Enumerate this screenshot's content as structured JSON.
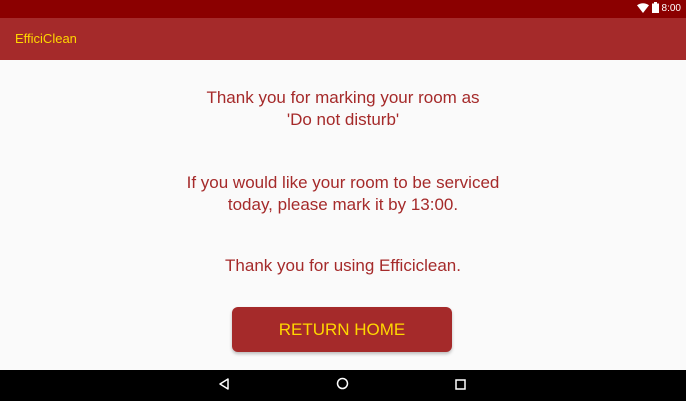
{
  "status_bar": {
    "time": "8:00",
    "icons": [
      "wifi-icon",
      "battery-icon"
    ],
    "background": "#8b0000"
  },
  "app_bar": {
    "title": "EfficiClean",
    "background": "#a52a2a",
    "title_color": "#ffd700"
  },
  "content": {
    "messages": [
      "Thank you for marking your room as\n'Do not disturb'",
      "If you would like your room to be serviced\ntoday, please mark it by 13:00.",
      "Thank you for using Efficiclean."
    ],
    "text_color": "#a52a2a",
    "return_button": {
      "label": "RETURN HOME",
      "background": "#a52a2a",
      "text_color": "#ffd700"
    }
  },
  "nav_bar": {
    "buttons": [
      "back-icon",
      "home-icon",
      "recents-icon"
    ],
    "background": "#000000"
  }
}
